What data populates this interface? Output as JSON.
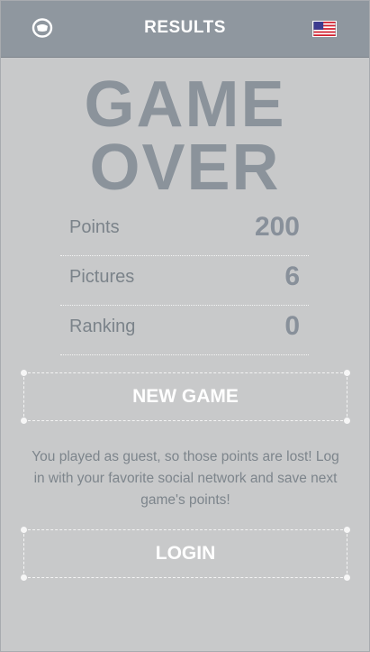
{
  "header": {
    "title": "RESULTS",
    "left_icon": "astronaut-helmet-icon",
    "right_icon": "us-flag-icon"
  },
  "hero": {
    "line1": "GAME",
    "line2": "OVER"
  },
  "stats": [
    {
      "label": "Points",
      "value": "200"
    },
    {
      "label": "Pictures",
      "value": "6"
    },
    {
      "label": "Ranking",
      "value": "0"
    }
  ],
  "actions": {
    "new_game": "NEW GAME",
    "login": "LOGIN"
  },
  "guest_message": "You played as guest, so those points are lost! Log in with your favorite social network and save next game's points!",
  "colors": {
    "header_bg": "#8f979f",
    "page_bg": "#c8c9ca",
    "headline": "#8b939b",
    "text": "#7b838a",
    "button_text": "#ffffff"
  }
}
